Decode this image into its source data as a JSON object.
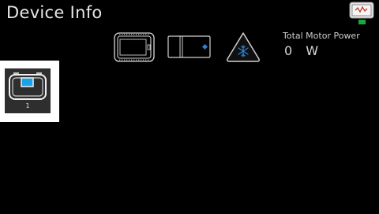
{
  "page": {
    "title": "Device Info"
  },
  "toolbar": {
    "icons": [
      {
        "name": "brain-icon"
      },
      {
        "name": "controller-icon"
      },
      {
        "name": "field-control-icon"
      }
    ]
  },
  "power": {
    "label": "Total Motor Power",
    "value": "0",
    "unit": "W"
  },
  "devices": [
    {
      "port": "1",
      "icon": "battery-device-icon"
    }
  ],
  "colors": {
    "accent": "#1aa3e8",
    "status_green": "#1fa53a",
    "field_blue": "#2f7fd0"
  }
}
